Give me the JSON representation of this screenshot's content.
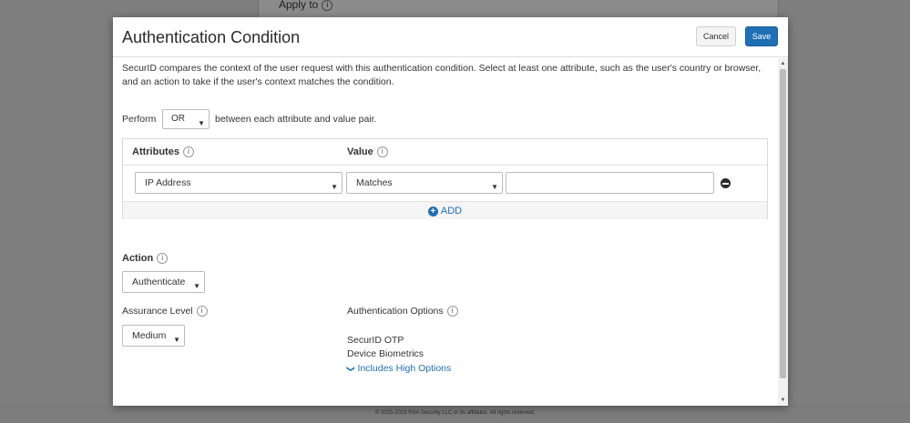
{
  "background": {
    "apply_to_label": "Apply to",
    "info": "i",
    "footer": "© 2015-2023 RSA Security LLC or its affiliates. All rights reserved."
  },
  "modal": {
    "title": "Authentication Condition",
    "cancel_label": "Cancel",
    "save_label": "Save",
    "description": "SecurID compares the context of the user request with this authentication condition. Select at least one attribute, such as the user's country or browser, and an action to take if the user's context matches the condition.",
    "perform": {
      "label": "Perform",
      "selected": "OR",
      "tail": "between each attribute and value pair."
    },
    "table": {
      "attributes_header": "Attributes",
      "value_header": "Value",
      "info": "i",
      "rows": [
        {
          "attribute": "IP Address",
          "operator": "Matches",
          "value": ""
        }
      ],
      "add_label": "ADD",
      "add_symbol": "+"
    },
    "action": {
      "label": "Action",
      "selected": "Authenticate"
    },
    "assurance": {
      "label": "Assurance Level",
      "selected": "Medium"
    },
    "auth_options": {
      "label": "Authentication Options",
      "items": [
        "SecurID OTP",
        "Device Biometrics"
      ],
      "high_options_link": "Includes High Options"
    }
  },
  "colors": {
    "accent": "#1f6fb5",
    "overlay": "#7f7f7f"
  }
}
